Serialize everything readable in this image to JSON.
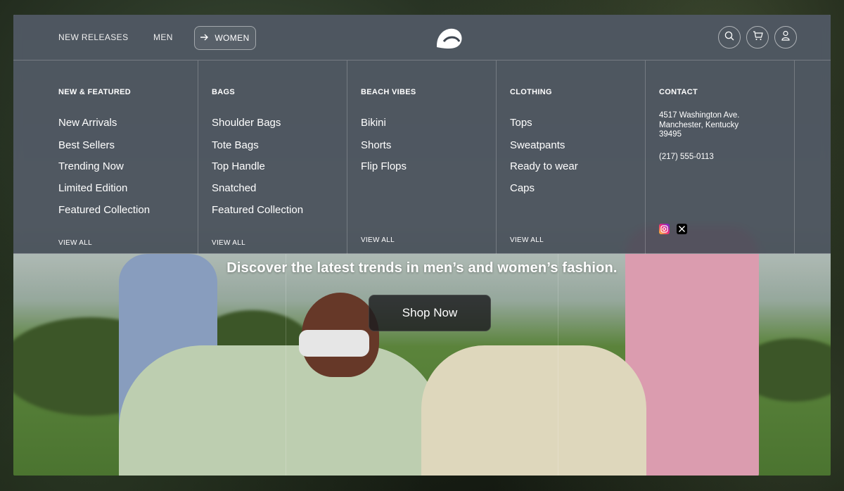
{
  "nav": {
    "links": [
      "NEW RELEASES",
      "MEN"
    ],
    "active": "WOMEN"
  },
  "columns": [
    {
      "title": "NEW & FEATURED",
      "items": [
        "New Arrivals",
        "Best Sellers",
        "Trending Now",
        "Limited Edition",
        "Featured Collection"
      ],
      "view_all": "VIEW ALL"
    },
    {
      "title": "BAGS",
      "items": [
        "Shoulder Bags",
        "Tote Bags",
        "Top Handle",
        "Snatched",
        "Featured Collection"
      ],
      "view_all": "VIEW ALL"
    },
    {
      "title": "BEACH VIBES",
      "items": [
        "Bikini",
        "Shorts",
        "Flip Flops"
      ],
      "view_all": "VIEW ALL"
    },
    {
      "title": "CLOTHING",
      "items": [
        "Tops",
        "Sweatpants",
        "Ready to wear",
        "Caps"
      ],
      "view_all": "VIEW ALL"
    }
  ],
  "contact": {
    "title": "CONTACT",
    "address_lines": [
      "4517 Washington Ave.",
      "Manchester, Kentucky",
      "39495"
    ],
    "phone": "(217) 555-0113"
  },
  "hero": {
    "tagline": "Discover the latest trends in men’s and women’s fashion.",
    "cta": "Shop Now"
  },
  "icons": [
    "arrow-right-icon",
    "search-icon",
    "cart-icon",
    "user-icon",
    "instagram-icon",
    "x-icon"
  ],
  "colors": {
    "panel": "#3e4650",
    "instagram": "#d6249f",
    "text": "#ffffff"
  }
}
